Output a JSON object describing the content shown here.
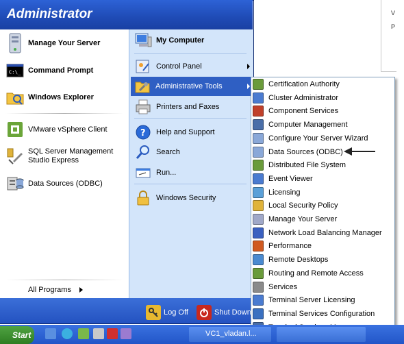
{
  "header": {
    "title": "Administrator"
  },
  "left_items": [
    {
      "label": "Manage Your Server",
      "icon": "server-icon"
    },
    {
      "label": "Command Prompt",
      "icon": "cmd-icon",
      "icon_text": "C:\\_"
    },
    {
      "label": "Windows Explorer",
      "icon": "explorer-icon"
    },
    {
      "label": "VMware vSphere Client",
      "icon": "vmware-icon"
    },
    {
      "label": "SQL Server Management Studio Express",
      "label_line1": "SQL Server Management",
      "label_line2": "Studio Express",
      "icon": "sql-icon"
    },
    {
      "label": "Data Sources (ODBC)",
      "icon": "odbc-icon"
    }
  ],
  "all_programs": "All Programs",
  "right_items": [
    {
      "label": "My Computer",
      "icon": "my-computer-icon"
    },
    {
      "label": "Control Panel",
      "icon": "control-panel-icon"
    },
    {
      "label": "Administrative Tools",
      "icon": "admin-tools-icon"
    },
    {
      "label": "Printers and Faxes",
      "icon": "printer-icon"
    },
    {
      "label": "Help and Support",
      "icon": "help-icon"
    },
    {
      "label": "Search",
      "icon": "search-icon"
    },
    {
      "label": "Run...",
      "icon": "run-icon"
    },
    {
      "label": "Windows Security",
      "icon": "lock-icon"
    }
  ],
  "footer": {
    "logoff": "Log Off",
    "shutdown": "Shut Down"
  },
  "submenu": [
    "Certification Authority",
    "Cluster Administrator",
    "Component Services",
    "Computer Management",
    "Configure Your Server Wizard",
    "Data Sources (ODBC)",
    "Distributed File System",
    "Event Viewer",
    "Licensing",
    "Local Security Policy",
    "Manage Your Server",
    "Network Load Balancing Manager",
    "Performance",
    "Remote Desktops",
    "Routing and Remote Access",
    "Services",
    "Terminal Server Licensing",
    "Terminal Services Configuration",
    "Terminal Services Manager"
  ],
  "taskbar": {
    "start": "Start",
    "task1": "VC1_vladan.l..."
  },
  "colors": {
    "header": "#1f4bb5",
    "highlight": "#2f5fc3",
    "right_panel": "#d3e5fa"
  }
}
